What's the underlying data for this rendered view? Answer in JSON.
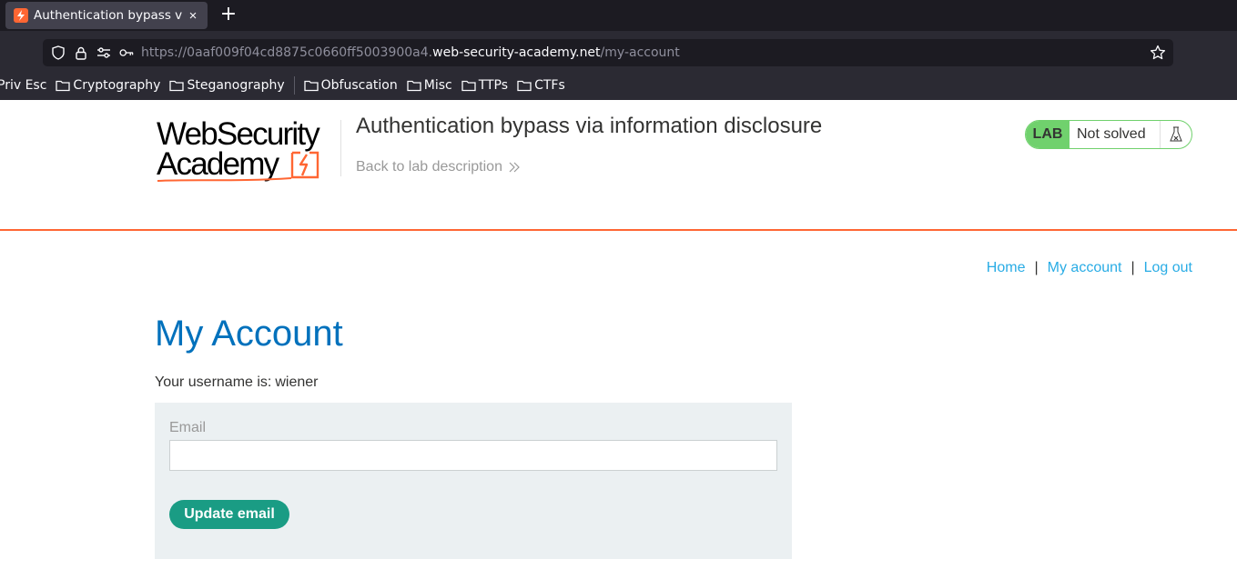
{
  "browser": {
    "tab_title": "Authentication bypass via information disclosure",
    "tab_close": "×",
    "new_tab": "+",
    "url_prefix": "https://0aaf009f04cd8875c0660ff5003900a4.",
    "url_host": "web-security-academy.net",
    "url_path": "/my-account",
    "bookmarks": [
      "Priv Esc",
      "Cryptography",
      "Steganography",
      "Obfuscation",
      "Misc",
      "TTPs",
      "CTFs"
    ]
  },
  "header": {
    "logo_line1": "WebSecurity",
    "logo_line2": "Academy",
    "lab_title": "Authentication bypass via information disclosure",
    "back_link": "Back to lab description",
    "lab_badge": "LAB",
    "lab_state": "Not solved"
  },
  "nav": {
    "home": "Home",
    "sep1": "|",
    "my_account": "My account",
    "sep2": "|",
    "log_out": "Log out"
  },
  "main": {
    "heading": "My Account",
    "username_label": "Your username is:",
    "username_value": "wiener",
    "email_label": "Email",
    "email_value": "",
    "update_button": "Update email"
  },
  "colors": {
    "accent_orange": "#ff6633",
    "heading_blue": "#0071bc",
    "link_blue": "#29ace5",
    "button_green": "#1a9c84",
    "lab_green": "#70d16d"
  }
}
